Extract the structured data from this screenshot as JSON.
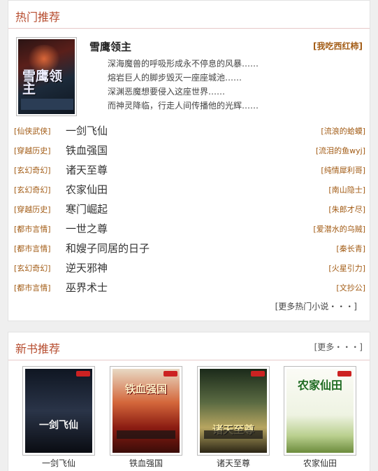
{
  "hot": {
    "title": "热门推荐",
    "featured": {
      "cover_icon": "book-cover",
      "title": "雪鹰领主",
      "author": "[我吃西红柿]",
      "lines": [
        "深海魔兽的呼吸形成永不停息的风暴……",
        "熔岩巨人的脚步毁灭一座座城池……",
        "深渊恶魔想要侵入这座世界……",
        "而神灵降临，行走人间传播他的光辉……"
      ]
    },
    "list": [
      {
        "genre": "[仙侠武侠]",
        "title": "一剑飞仙",
        "author": "[流浪的蛤蟆]"
      },
      {
        "genre": "[穿越历史]",
        "title": "铁血强国",
        "author": "[流泪的鱼wyj]"
      },
      {
        "genre": "[玄幻奇幻]",
        "title": "诸天至尊",
        "author": "[纯情犀利哥]"
      },
      {
        "genre": "[玄幻奇幻]",
        "title": "农家仙田",
        "author": "[南山隐士]"
      },
      {
        "genre": "[穿越历史]",
        "title": "寒门崛起",
        "author": "[朱郎才尽]"
      },
      {
        "genre": "[都市言情]",
        "title": "一世之尊",
        "author": "[爱潜水的乌贼]"
      },
      {
        "genre": "[都市言情]",
        "title": "和嫂子同居的日子",
        "author": "[秦长青]"
      },
      {
        "genre": "[玄幻奇幻]",
        "title": "逆天邪神",
        "author": "[火星引力]"
      },
      {
        "genre": "[都市言情]",
        "title": "巫界术士",
        "author": "[文抄公]"
      }
    ],
    "more": "[更多热门小说・・・]"
  },
  "new": {
    "title": "新书推荐",
    "more": "[更多・・・]",
    "books": [
      {
        "title": "一剑飞仙",
        "cover_text": "一剑飞仙"
      },
      {
        "title": "铁血强国",
        "cover_text": "铁血强国"
      },
      {
        "title": "诸天至尊",
        "cover_text": "诸天至尊"
      },
      {
        "title": "农家仙田",
        "cover_text": "农家仙田"
      }
    ]
  }
}
